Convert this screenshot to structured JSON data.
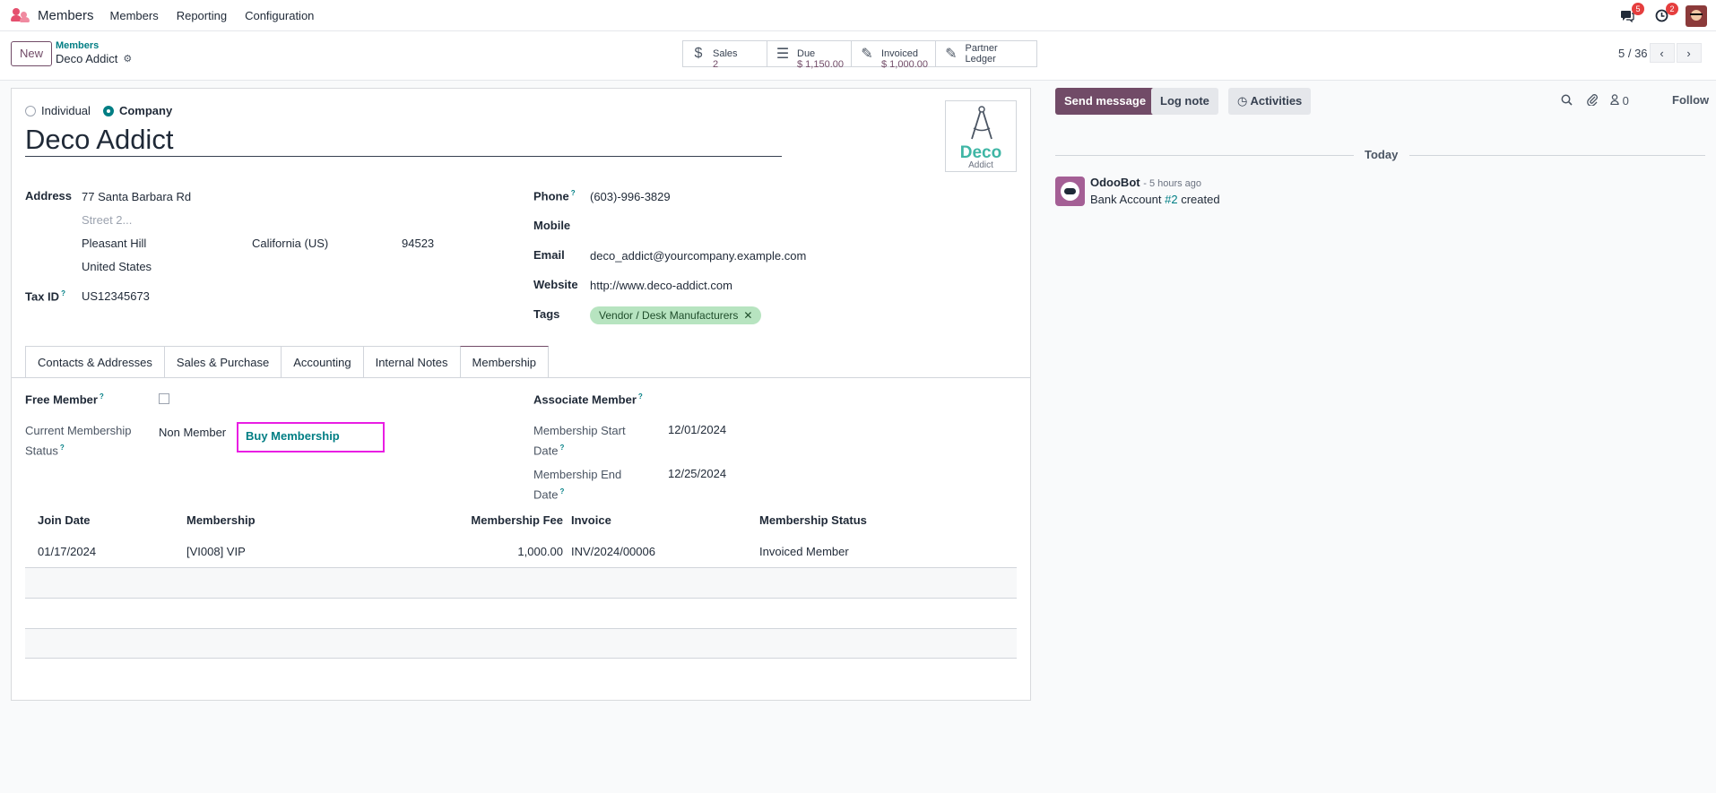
{
  "navbar": {
    "app_name": "Members",
    "menu": [
      "Members",
      "Reporting",
      "Configuration"
    ],
    "messages_count": "5",
    "activities_count": "2"
  },
  "control": {
    "new_label": "New",
    "breadcrumb_parent": "Members",
    "breadcrumb_current": "Deco Addict",
    "smart_buttons": [
      {
        "label": "Sales",
        "value": "2",
        "icon": "dollar-icon"
      },
      {
        "label": "Due",
        "value": "$ 1,150.00",
        "icon": "list-icon"
      },
      {
        "label": "Invoiced",
        "value": "$ 1,000.00",
        "icon": "edit-icon"
      },
      {
        "label": "Partner Ledger",
        "value": "",
        "icon": "edit-icon"
      }
    ],
    "pager": "5 / 36"
  },
  "form": {
    "type_individual": "Individual",
    "type_company": "Company",
    "name": "Deco Addict",
    "logo_text_1": "Deco",
    "logo_text_2": "Addict",
    "address_label": "Address",
    "street": "77 Santa Barbara Rd",
    "street2_placeholder": "Street 2...",
    "city": "Pleasant Hill",
    "state": "California (US)",
    "zip": "94523",
    "country": "United States",
    "tax_id_label": "Tax ID",
    "tax_id": "US12345673",
    "phone_label": "Phone",
    "phone": "(603)-996-3829",
    "mobile_label": "Mobile",
    "email_label": "Email",
    "email": "deco_addict@yourcompany.example.com",
    "website_label": "Website",
    "website": "http://www.deco-addict.com",
    "tags_label": "Tags",
    "tag": "Vendor / Desk Manufacturers"
  },
  "tabs": [
    "Contacts & Addresses",
    "Sales & Purchase",
    "Accounting",
    "Internal Notes",
    "Membership"
  ],
  "membership": {
    "free_member_label": "Free Member",
    "free_member_checked": false,
    "status_label_1": "Current Membership",
    "status_label_2": "Status",
    "status_value": "Non Member",
    "buy_label": "Buy Membership",
    "associate_label": "Associate Member",
    "start_label_1": "Membership Start",
    "start_label_2": "Date",
    "start_value": "12/01/2024",
    "end_label_1": "Membership End",
    "end_label_2": "Date",
    "end_value": "12/25/2024"
  },
  "table": {
    "headers": [
      "Join Date",
      "Membership",
      "Membership Fee",
      "Invoice",
      "Membership Status"
    ],
    "rows": [
      [
        "01/17/2024",
        "[VI008] VIP",
        "1,000.00",
        "INV/2024/00006",
        "Invoiced Member"
      ]
    ]
  },
  "chatter": {
    "send_message": "Send message",
    "log_note": "Log note",
    "activities": "Activities",
    "followers_count": "0",
    "follow": "Follow",
    "today": "Today",
    "author": "OdooBot",
    "time": "- 5 hours ago",
    "body_prefix": "Bank Account",
    "body_link": "#2",
    "body_suffix": "created"
  }
}
